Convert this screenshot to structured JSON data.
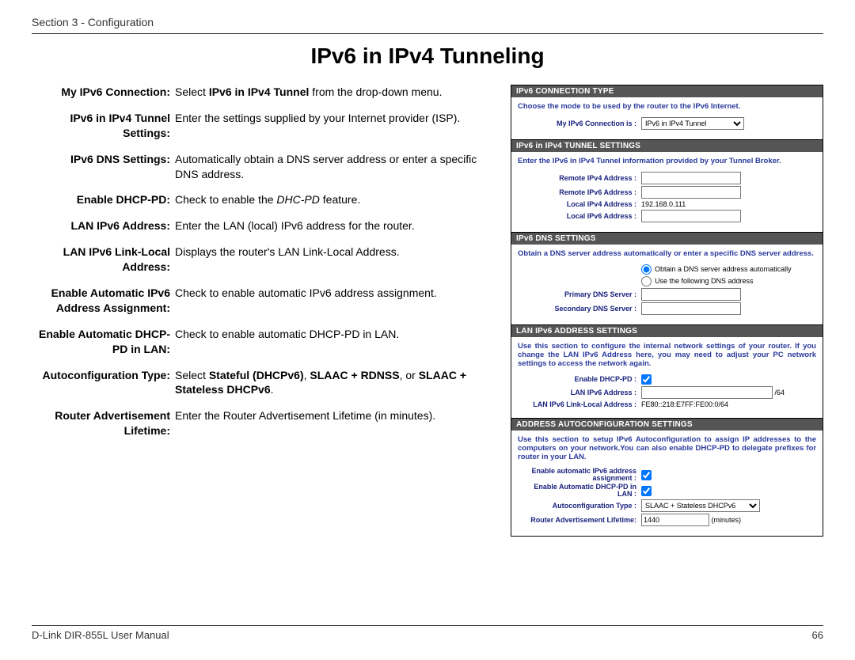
{
  "header": {
    "section": "Section 3 - Configuration"
  },
  "title": "IPv6 in IPv4 Tunneling",
  "defs": [
    {
      "term": "My IPv6 Connection:",
      "desc": "Select <b>IPv6 in IPv4 Tunnel</b> from the drop-down menu."
    },
    {
      "term": "IPv6 in IPv4 Tunnel Settings:",
      "desc": "Enter the settings supplied by your Internet provider (ISP)."
    },
    {
      "term": "IPv6 DNS Settings:",
      "desc": "Automatically obtain a DNS server address or enter a specific DNS address."
    },
    {
      "term": "Enable DHCP-PD:",
      "desc": "Check to enable the <i>DHC-PD</i> feature."
    },
    {
      "term": "LAN IPv6 Address:",
      "desc": "Enter the LAN (local) IPv6 address for the router."
    },
    {
      "term": "LAN IPv6 Link-Local Address:",
      "desc": "Displays the router's LAN Link-Local Address."
    },
    {
      "term": "Enable Automatic IPv6 Address Assignment:",
      "desc": "Check to enable automatic IPv6 address assignment."
    },
    {
      "term": "Enable Automatic DHCP-PD in LAN:",
      "desc": "Check to enable automatic DHCP-PD in LAN."
    },
    {
      "term": "Autoconfiguration Type:",
      "desc": "Select <b>Stateful (DHCPv6)</b>, <b>SLAAC + RDNSS</b>, or <b>SLAAC + Stateless DHCPv6</b>."
    },
    {
      "term": "Router Advertisement Lifetime:",
      "desc": "Enter the Router Advertisement Lifetime (in minutes)."
    }
  ],
  "panel": {
    "conn_type": {
      "header": "IPv6 CONNECTION TYPE",
      "blurb": "Choose the mode to be used by the router to the IPv6 Internet.",
      "label": "My IPv6 Connection is :",
      "value": "IPv6 in IPv4 Tunnel"
    },
    "tunnel": {
      "header": "IPv6 in IPv4 TUNNEL SETTINGS",
      "blurb": "Enter the IPv6 in IPv4 Tunnel information provided by your Tunnel Broker.",
      "remote_v4_label": "Remote IPv4 Address :",
      "remote_v4": "",
      "remote_v6_label": "Remote IPv6 Address :",
      "remote_v6": "",
      "local_v4_label": "Local IPv4 Address :",
      "local_v4": "192.168.0.111",
      "local_v6_label": "Local IPv6 Address :",
      "local_v6": ""
    },
    "dns": {
      "header": "IPv6 DNS SETTINGS",
      "blurb": "Obtain a DNS server address automatically or enter a specific DNS server address.",
      "radio_auto": "Obtain a DNS server address automatically",
      "radio_manual": "Use the following DNS address",
      "primary_label": "Primary DNS Server :",
      "primary": "",
      "secondary_label": "Secondary DNS Server :",
      "secondary": ""
    },
    "lan": {
      "header": "LAN IPv6 ADDRESS SETTINGS",
      "blurb": "Use this section to configure the internal network settings of your router. If you change the LAN IPv6 Address here, you may need to adjust your PC network settings to access the network again.",
      "enable_dhcppd_label": "Enable DHCP-PD :",
      "lan_addr_label": "LAN IPv6 Address :",
      "lan_addr": "",
      "lan_suffix": "/64",
      "linklocal_label": "LAN IPv6 Link-Local Address :",
      "linklocal_value": "FE80::218:E7FF:FE00:0/64"
    },
    "auto": {
      "header": "ADDRESS AUTOCONFIGURATION SETTINGS",
      "blurb": "Use this section to setup IPv6 Autoconfiguration to assign IP addresses to the computers on your network.You can also enable DHCP-PD to delegate prefixes for router in your LAN.",
      "auto_assign_label": "Enable automatic IPv6 address assignment :",
      "auto_dhcppd_lan_label": "Enable Automatic DHCP-PD in LAN :",
      "type_label": "Autoconfiguration Type :",
      "type_value": "SLAAC + Stateless DHCPv6",
      "ra_label": "Router Advertisement Lifetime:",
      "ra_value": "1440",
      "ra_units": "(minutes)"
    }
  },
  "footer": {
    "left": "D-Link DIR-855L User Manual",
    "right": "66"
  }
}
